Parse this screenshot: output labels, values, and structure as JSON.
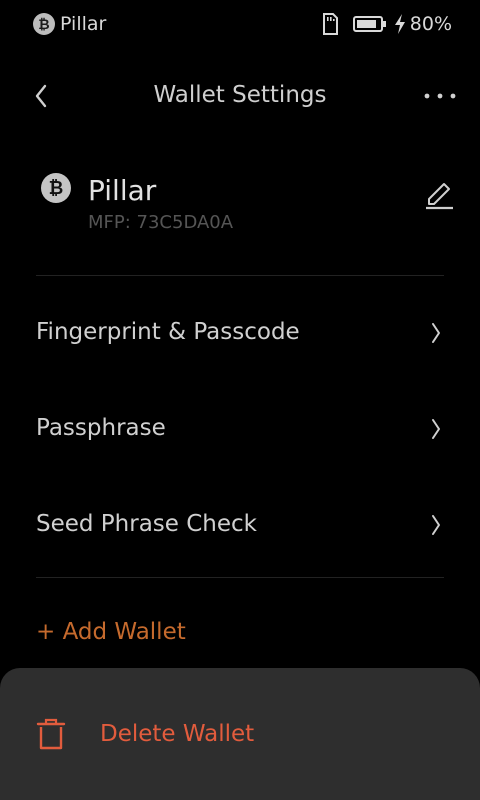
{
  "status_bar": {
    "wallet_name": "Pillar",
    "coin_symbol": "₿",
    "battery_percent": "80%"
  },
  "header": {
    "title": "Wallet Settings"
  },
  "wallet": {
    "name": "Pillar",
    "mfp": "MFP: 73C5DA0A",
    "coin_symbol": "₿"
  },
  "menu": {
    "items": [
      {
        "label": "Fingerprint & Passcode"
      },
      {
        "label": "Passphrase"
      },
      {
        "label": "Seed Phrase Check"
      }
    ]
  },
  "add_wallet": {
    "label": "+ Add Wallet"
  },
  "delete_sheet": {
    "label": "Delete Wallet"
  },
  "colors": {
    "background": "#000000",
    "accent_orange": "#c56a2d",
    "danger": "#e25c3d",
    "sheet": "#2e2e2e"
  },
  "icons": {
    "status": [
      "bitcoin-icon",
      "sd-card-icon",
      "battery-icon",
      "charging-bolt-icon"
    ],
    "header": [
      "back-arrow-icon",
      "more-dots-icon"
    ],
    "wallet": [
      "bitcoin-icon",
      "edit-pencil-icon"
    ],
    "menu": [
      "chevron-right-icon"
    ],
    "sheet": [
      "trash-icon"
    ]
  }
}
